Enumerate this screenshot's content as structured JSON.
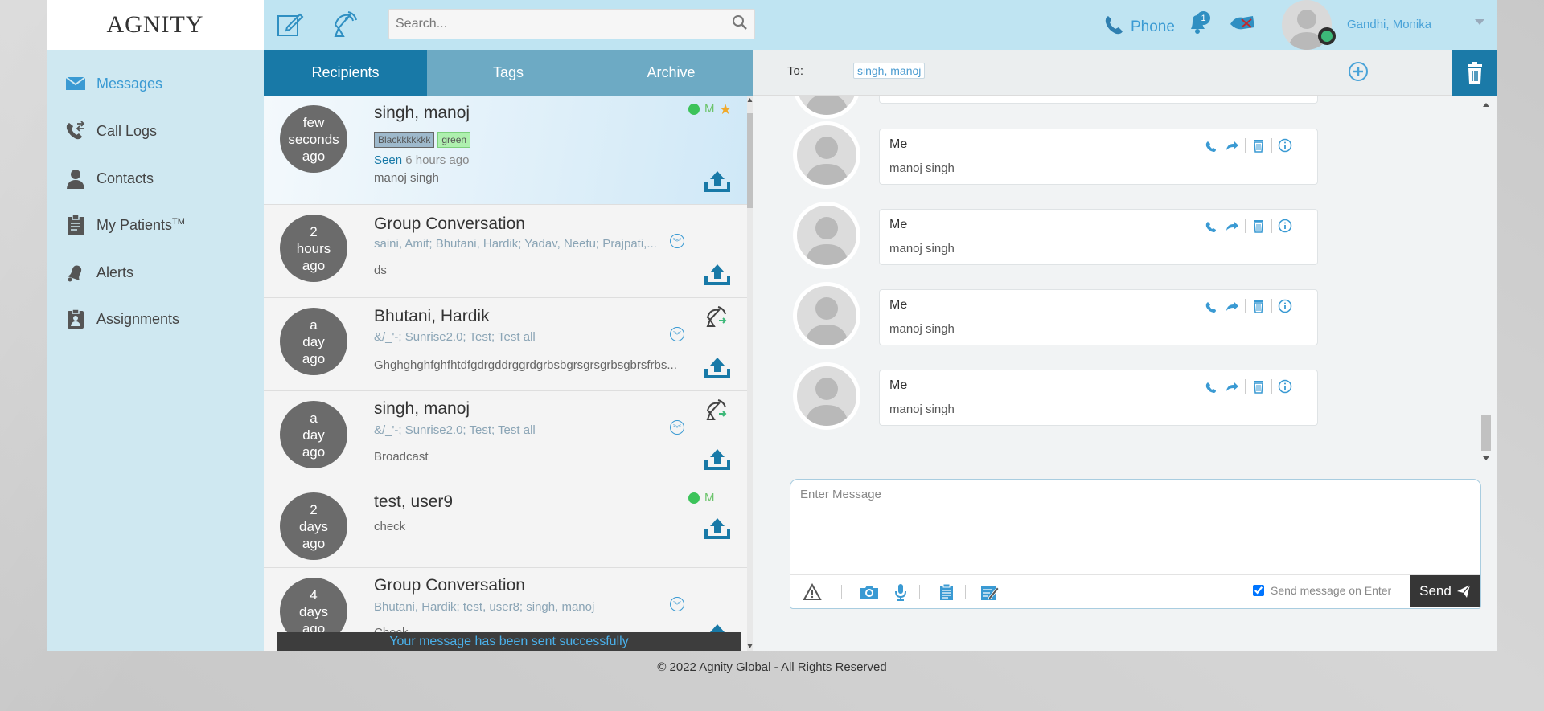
{
  "brand": {
    "logo_text": "AGNITY"
  },
  "header": {
    "search_placeholder": "Search...",
    "phone_label": "Phone",
    "notification_count": "1",
    "user_name": "Gandhi, Monika"
  },
  "sidebar": {
    "items": [
      {
        "label": "Messages",
        "icon": "envelope-icon",
        "active": true
      },
      {
        "label": "Call Logs",
        "icon": "call-logs-icon"
      },
      {
        "label": "Contacts",
        "icon": "contact-icon"
      },
      {
        "label": "My Patients",
        "sup": "TM",
        "icon": "clipboard-icon"
      },
      {
        "label": "Alerts",
        "icon": "alert-bell-icon"
      },
      {
        "label": "Assignments",
        "icon": "assignment-icon"
      }
    ]
  },
  "tabs": [
    "Recipients",
    "Tags",
    "Archive"
  ],
  "conversations": [
    {
      "time": [
        "few",
        "seconds",
        "ago"
      ],
      "title": "singh, manoj",
      "tags": [
        "Blackkkkkkk",
        "green"
      ],
      "seen_label": "Seen",
      "seen_time": "6 hours ago",
      "message": "manoj singh",
      "status": "M"
    },
    {
      "time": [
        "2",
        "hours",
        "ago"
      ],
      "title": "Group Conversation",
      "members": "saini, Amit; Bhutani, Hardik; Yadav, Neetu; Prajpati,...",
      "message": "ds"
    },
    {
      "time": [
        "a",
        "day",
        "ago"
      ],
      "title": "Bhutani, Hardik",
      "members": "&/_'-; Sunrise2.0; Test; Test all",
      "message": "Ghghghghfghfhtdfgdrgddrggrdgrbsbgrsgrsgrbsgbrsfrbs..."
    },
    {
      "time": [
        "a",
        "day",
        "ago"
      ],
      "title": "singh, manoj",
      "members": "&/_'-; Sunrise2.0; Test; Test all",
      "message": "Broadcast"
    },
    {
      "time": [
        "2",
        "days",
        "ago"
      ],
      "title": "test, user9",
      "message": "check",
      "status": "M"
    },
    {
      "time": [
        "4",
        "days",
        "ago"
      ],
      "title": "Group Conversation",
      "members": "Bhutani, Hardik; test, user8; singh, manoj",
      "message": "Check"
    }
  ],
  "toast": "Your message has been sent successfully",
  "chat": {
    "to_label": "To:",
    "to_recipient": "singh, manoj",
    "messages": [
      {
        "sender": "Me",
        "text": "manoj singh"
      },
      {
        "sender": "Me",
        "text": "manoj singh"
      },
      {
        "sender": "Me",
        "text": "manoj singh"
      },
      {
        "sender": "Me",
        "text": "manoj singh"
      }
    ],
    "compose_placeholder": "Enter Message",
    "send_on_enter_label": "Send message on Enter",
    "send_on_enter_checked": true,
    "send_label": "Send"
  },
  "footer": "© 2022 Agnity Global - All Rights Reserved",
  "colors": {
    "accent": "#3a9ad3",
    "tab_active": "#1879a7",
    "header_bg": "#bfe4f2"
  }
}
